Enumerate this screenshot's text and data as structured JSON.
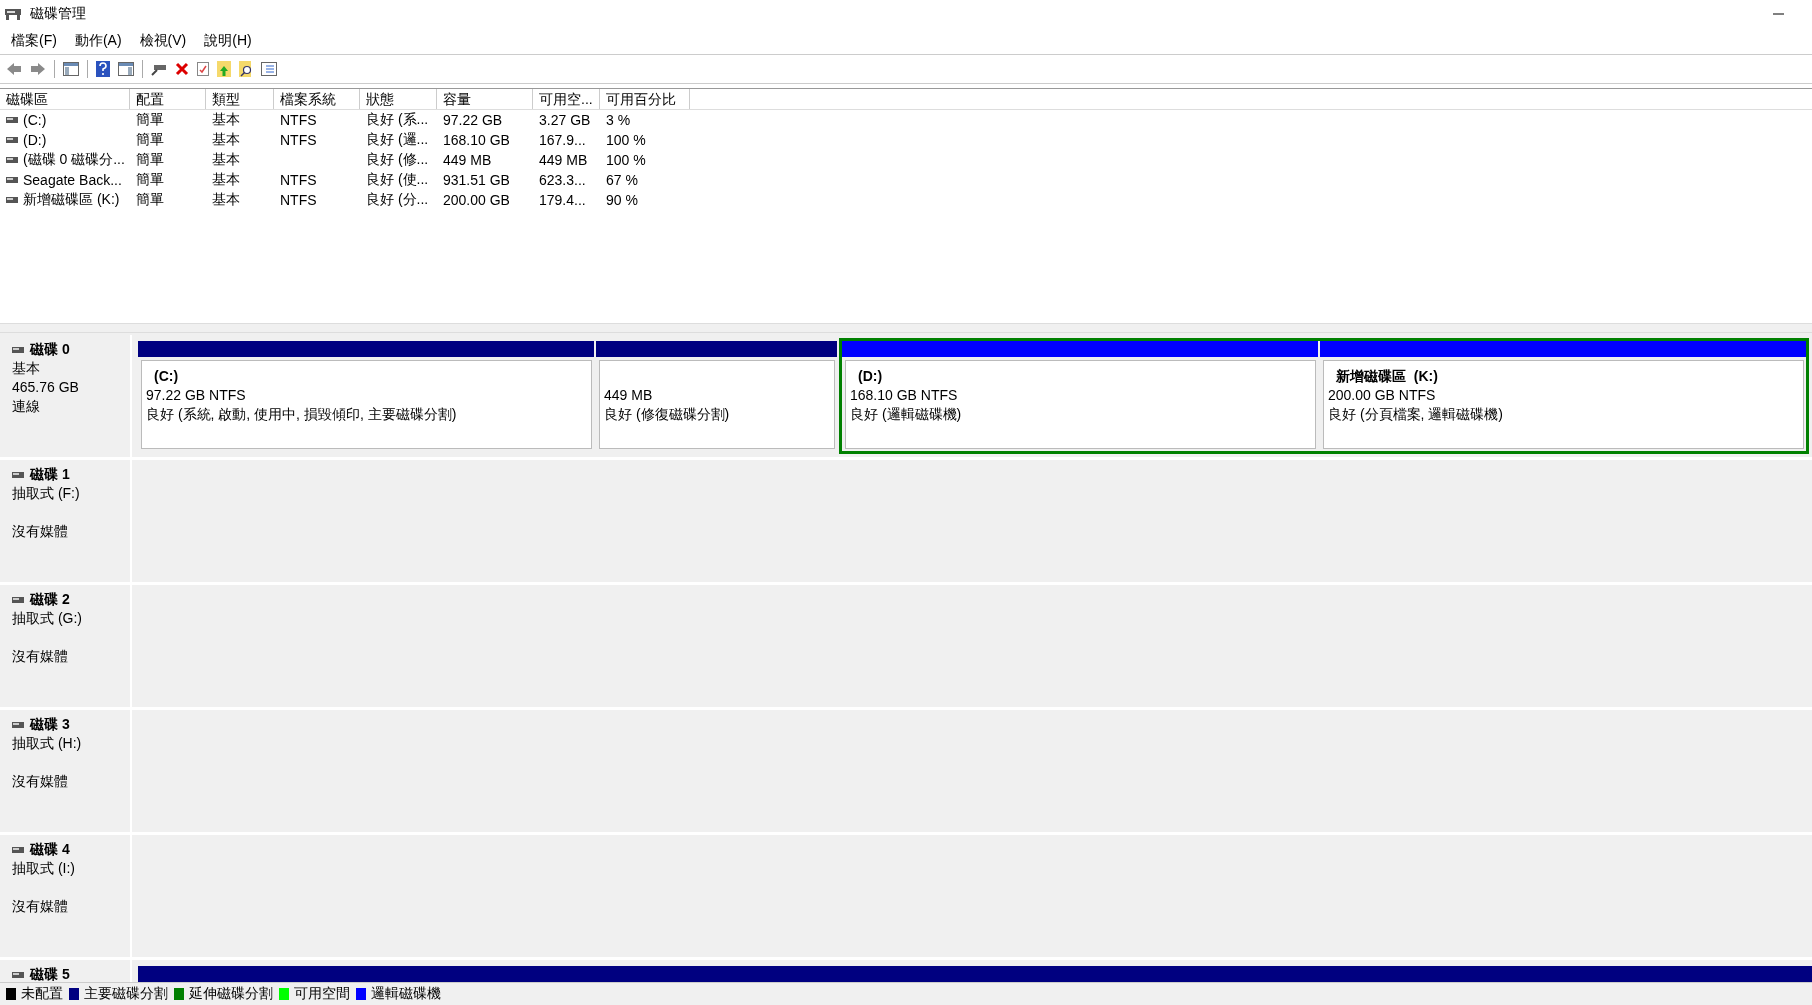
{
  "window": {
    "title": "磁碟管理"
  },
  "menu": [
    "檔案(F)",
    "動作(A)",
    "檢視(V)",
    "說明(H)"
  ],
  "volumes": {
    "columns": [
      "磁碟區",
      "配置",
      "類型",
      "檔案系統",
      "狀態",
      "容量",
      "可用空...",
      "可用百分比"
    ],
    "rows": [
      [
        "(C:)",
        "簡單",
        "基本",
        "NTFS",
        "良好 (系...",
        "97.22 GB",
        "3.27 GB",
        "3 %"
      ],
      [
        "(D:)",
        "簡單",
        "基本",
        "NTFS",
        "良好 (邏...",
        "168.10 GB",
        "167.9...",
        "100 %"
      ],
      [
        "(磁碟 0 磁碟分...",
        "簡單",
        "基本",
        "",
        "良好 (修...",
        "449 MB",
        "449 MB",
        "100 %"
      ],
      [
        "Seagate Back...",
        "簡單",
        "基本",
        "NTFS",
        "良好 (使...",
        "931.51 GB",
        "623.3...",
        "67 %"
      ],
      [
        "新增磁碟區 (K:)",
        "簡單",
        "基本",
        "NTFS",
        "良好 (分...",
        "200.00 GB",
        "179.4...",
        "90 %"
      ]
    ]
  },
  "disks": [
    {
      "kind": "basic",
      "name": "磁碟 0",
      "lines": [
        "基本",
        "465.76 GB",
        "連線"
      ],
      "partitions": [
        {
          "kind": "primary",
          "color": "#000080",
          "label": "(C:)",
          "size": "97.22 GB NTFS",
          "status": "良好 (系統, 啟動, 使用中, 損毀傾印, 主要磁碟分割)"
        },
        {
          "kind": "primary",
          "color": "#000080",
          "size": "449 MB",
          "status": "良好 (修復磁碟分割)"
        },
        {
          "kind": "extended",
          "color": "#008000",
          "children": [
            {
              "kind": "logical",
              "color": "#0000ff",
              "label": "(D:)",
              "size": "168.10 GB NTFS",
              "status": "良好 (邏輯磁碟機)"
            },
            {
              "kind": "logical",
              "color": "#0000ff",
              "label": "新增磁碟區  (K:)",
              "size": "200.00 GB NTFS",
              "status": "良好 (分頁檔案, 邏輯磁碟機)"
            }
          ]
        }
      ]
    },
    {
      "kind": "removable",
      "name": "磁碟 1",
      "lines": [
        "抽取式 (F:)",
        "沒有媒體"
      ]
    },
    {
      "kind": "removable",
      "name": "磁碟 2",
      "lines": [
        "抽取式 (G:)",
        "沒有媒體"
      ]
    },
    {
      "kind": "removable",
      "name": "磁碟 3",
      "lines": [
        "抽取式 (H:)",
        "沒有媒體"
      ]
    },
    {
      "kind": "removable",
      "name": "磁碟 4",
      "lines": [
        "抽取式 (I:)",
        "沒有媒體"
      ]
    },
    {
      "kind": "partial",
      "name": "磁碟 5",
      "partitions": [
        {
          "kind": "primary",
          "color": "#000080"
        }
      ]
    }
  ],
  "legend": [
    {
      "label": "未配置",
      "color": "#000000"
    },
    {
      "label": "主要磁碟分割",
      "color": "#000080"
    },
    {
      "label": "延伸磁碟分割",
      "color": "#008000"
    },
    {
      "label": "可用空間",
      "color": "#00ff00"
    },
    {
      "label": "邏輯磁碟機",
      "color": "#0000ff"
    }
  ]
}
